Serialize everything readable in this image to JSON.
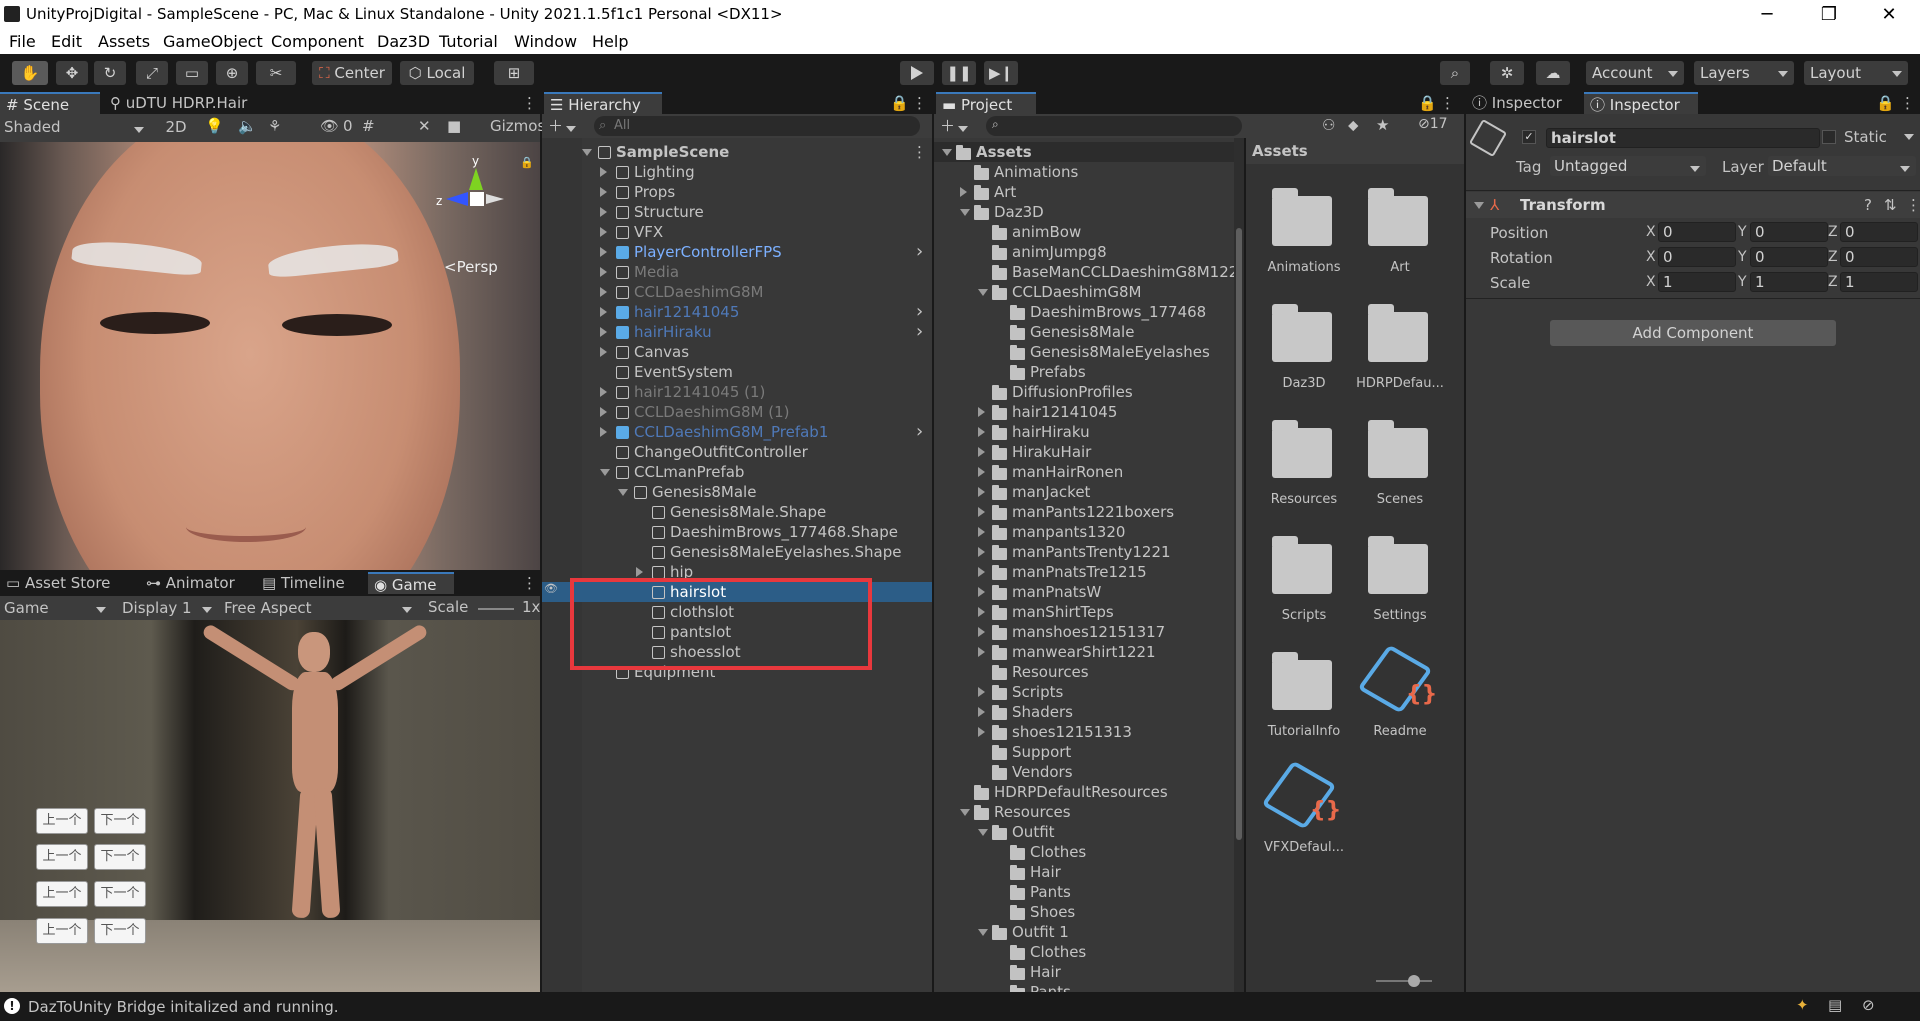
{
  "window": {
    "title": "UnityProjDigital - SampleScene - PC, Mac & Linux Standalone - Unity 2021.1.5f1c1 Personal <DX11>"
  },
  "menu": [
    "File",
    "Edit",
    "Assets",
    "GameObject",
    "Component",
    "Daz3D",
    "Tutorial",
    "Window",
    "Help"
  ],
  "toolbar": {
    "center": "Center",
    "local": "Local",
    "account": "Account",
    "layers": "Layers",
    "layout": "Layout"
  },
  "scene": {
    "tabs": [
      "Scene",
      "uDTU HDRP.Hair"
    ],
    "shading": "Shaded",
    "mode2d": "2D",
    "hidden_count": "0",
    "gizmos": "Gizmos",
    "persp": "<Persp",
    "axis_y": "y",
    "axis_z": "z"
  },
  "game": {
    "tabs": [
      "Asset Store",
      "Animator",
      "Timeline",
      "Game"
    ],
    "display_mode": "Game",
    "display": "Display 1",
    "aspect": "Free Aspect",
    "scale_label": "Scale",
    "scale_value": "1x",
    "buttons": [
      "上一个",
      "下一个",
      "上一个",
      "下一个",
      "上一个",
      "下一个",
      "上一个",
      "下一个"
    ]
  },
  "hierarchy": {
    "tab": "Hierarchy",
    "search_placeholder": "All",
    "items": [
      {
        "label": "SampleScene",
        "depth": 0,
        "exp": "open",
        "icon": "scene",
        "style": "bold"
      },
      {
        "label": "Lighting",
        "depth": 1,
        "exp": "closed",
        "icon": "cube",
        "style": "normal"
      },
      {
        "label": "Props",
        "depth": 1,
        "exp": "closed",
        "icon": "cube",
        "style": "normal"
      },
      {
        "label": "Structure",
        "depth": 1,
        "exp": "closed",
        "icon": "cube",
        "style": "normal"
      },
      {
        "label": "VFX",
        "depth": 1,
        "exp": "closed",
        "icon": "cube",
        "style": "normal"
      },
      {
        "label": "PlayerControllerFPS",
        "depth": 1,
        "exp": "closed",
        "icon": "prefab",
        "style": "prefab",
        "arrow": true
      },
      {
        "label": "Media",
        "depth": 1,
        "exp": "closed",
        "icon": "cube",
        "style": "dim"
      },
      {
        "label": "CCLDaeshimG8M",
        "depth": 1,
        "exp": "closed",
        "icon": "cube",
        "style": "dim"
      },
      {
        "label": "hair12141045",
        "depth": 1,
        "exp": "closed",
        "icon": "prefab",
        "style": "prefabdim",
        "arrow": true
      },
      {
        "label": "hairHiraku",
        "depth": 1,
        "exp": "closed",
        "icon": "prefab",
        "style": "prefabdim",
        "arrow": true
      },
      {
        "label": "Canvas",
        "depth": 1,
        "exp": "closed",
        "icon": "cube",
        "style": "normal"
      },
      {
        "label": "EventSystem",
        "depth": 1,
        "exp": "none",
        "icon": "cube",
        "style": "normal"
      },
      {
        "label": "hair12141045 (1)",
        "depth": 1,
        "exp": "closed",
        "icon": "cube",
        "style": "dim"
      },
      {
        "label": "CCLDaeshimG8M (1)",
        "depth": 1,
        "exp": "closed",
        "icon": "cube",
        "style": "dim"
      },
      {
        "label": "CCLDaeshimG8M_Prefab1",
        "depth": 1,
        "exp": "closed",
        "icon": "prefab",
        "style": "prefabdim",
        "arrow": true
      },
      {
        "label": "ChangeOutfitController",
        "depth": 1,
        "exp": "none",
        "icon": "cube",
        "style": "normal"
      },
      {
        "label": "CCLmanPrefab",
        "depth": 1,
        "exp": "open",
        "icon": "cube",
        "style": "normal"
      },
      {
        "label": "Genesis8Male",
        "depth": 2,
        "exp": "open",
        "icon": "cube",
        "style": "normal"
      },
      {
        "label": "Genesis8Male.Shape",
        "depth": 3,
        "exp": "none",
        "icon": "cube",
        "style": "normal"
      },
      {
        "label": "DaeshimBrows_177468.Shape",
        "depth": 3,
        "exp": "none",
        "icon": "cube",
        "style": "normal"
      },
      {
        "label": "Genesis8MaleEyelashes.Shape",
        "depth": 3,
        "exp": "none",
        "icon": "cube",
        "style": "normal"
      },
      {
        "label": "hip",
        "depth": 3,
        "exp": "closed",
        "icon": "cube",
        "style": "normal"
      },
      {
        "label": "hairslot",
        "depth": 3,
        "exp": "none",
        "icon": "cube",
        "style": "selected"
      },
      {
        "label": "clothslot",
        "depth": 3,
        "exp": "none",
        "icon": "cube",
        "style": "normal"
      },
      {
        "label": "pantslot",
        "depth": 3,
        "exp": "none",
        "icon": "cube",
        "style": "normal"
      },
      {
        "label": "shoesslot",
        "depth": 3,
        "exp": "none",
        "icon": "cube",
        "style": "normal"
      },
      {
        "label": "Equipment",
        "depth": 1,
        "exp": "none",
        "icon": "cube",
        "style": "normal"
      }
    ]
  },
  "project": {
    "tab": "Project",
    "hidden_count": "17",
    "breadcrumb": "Assets",
    "tree": [
      {
        "label": "Assets",
        "depth": 0,
        "exp": "open",
        "bold": true
      },
      {
        "label": "Animations",
        "depth": 1,
        "exp": "none"
      },
      {
        "label": "Art",
        "depth": 1,
        "exp": "closed"
      },
      {
        "label": "Daz3D",
        "depth": 1,
        "exp": "open"
      },
      {
        "label": "animBow",
        "depth": 2,
        "exp": "none"
      },
      {
        "label": "animJumpg8",
        "depth": 2,
        "exp": "none"
      },
      {
        "label": "BaseManCCLDaeshimG8M122",
        "depth": 2,
        "exp": "none"
      },
      {
        "label": "CCLDaeshimG8M",
        "depth": 2,
        "exp": "open"
      },
      {
        "label": "DaeshimBrows_177468",
        "depth": 3,
        "exp": "none"
      },
      {
        "label": "Genesis8Male",
        "depth": 3,
        "exp": "none"
      },
      {
        "label": "Genesis8MaleEyelashes",
        "depth": 3,
        "exp": "none"
      },
      {
        "label": "Prefabs",
        "depth": 3,
        "exp": "none"
      },
      {
        "label": "DiffusionProfiles",
        "depth": 2,
        "exp": "none"
      },
      {
        "label": "hair12141045",
        "depth": 2,
        "exp": "closed"
      },
      {
        "label": "hairHiraku",
        "depth": 2,
        "exp": "closed"
      },
      {
        "label": "HirakuHair",
        "depth": 2,
        "exp": "closed"
      },
      {
        "label": "manHairRonen",
        "depth": 2,
        "exp": "closed"
      },
      {
        "label": "manJacket",
        "depth": 2,
        "exp": "closed"
      },
      {
        "label": "manPants1221boxers",
        "depth": 2,
        "exp": "closed"
      },
      {
        "label": "manpants1320",
        "depth": 2,
        "exp": "closed"
      },
      {
        "label": "manPantsTrenty1221",
        "depth": 2,
        "exp": "closed"
      },
      {
        "label": "manPnatsTre1215",
        "depth": 2,
        "exp": "closed"
      },
      {
        "label": "manPnatsW",
        "depth": 2,
        "exp": "closed"
      },
      {
        "label": "manShirtTeps",
        "depth": 2,
        "exp": "closed"
      },
      {
        "label": "manshoes12151317",
        "depth": 2,
        "exp": "closed"
      },
      {
        "label": "manwearShirt1221",
        "depth": 2,
        "exp": "closed"
      },
      {
        "label": "Resources",
        "depth": 2,
        "exp": "none"
      },
      {
        "label": "Scripts",
        "depth": 2,
        "exp": "closed"
      },
      {
        "label": "Shaders",
        "depth": 2,
        "exp": "closed"
      },
      {
        "label": "shoes12151313",
        "depth": 2,
        "exp": "closed"
      },
      {
        "label": "Support",
        "depth": 2,
        "exp": "none"
      },
      {
        "label": "Vendors",
        "depth": 2,
        "exp": "none"
      },
      {
        "label": "HDRPDefaultResources",
        "depth": 1,
        "exp": "none"
      },
      {
        "label": "Resources",
        "depth": 1,
        "exp": "open"
      },
      {
        "label": "Outfit",
        "depth": 2,
        "exp": "open"
      },
      {
        "label": "Clothes",
        "depth": 3,
        "exp": "none"
      },
      {
        "label": "Hair",
        "depth": 3,
        "exp": "none"
      },
      {
        "label": "Pants",
        "depth": 3,
        "exp": "none"
      },
      {
        "label": "Shoes",
        "depth": 3,
        "exp": "none"
      },
      {
        "label": "Outfit 1",
        "depth": 2,
        "exp": "open"
      },
      {
        "label": "Clothes",
        "depth": 3,
        "exp": "none"
      },
      {
        "label": "Hair",
        "depth": 3,
        "exp": "none"
      },
      {
        "label": "Pants",
        "depth": 3,
        "exp": "none"
      }
    ],
    "grid": [
      {
        "label": "Animations",
        "type": "folder"
      },
      {
        "label": "Art",
        "type": "folder"
      },
      {
        "label": "Daz3D",
        "type": "folder"
      },
      {
        "label": "HDRPDefau...",
        "type": "folder"
      },
      {
        "label": "Resources",
        "type": "folder"
      },
      {
        "label": "Scenes",
        "type": "folder"
      },
      {
        "label": "Scripts",
        "type": "folder"
      },
      {
        "label": "Settings",
        "type": "folder"
      },
      {
        "label": "TutorialInfo",
        "type": "folder"
      },
      {
        "label": "Readme",
        "type": "asset"
      },
      {
        "label": "VFXDefaul...",
        "type": "asset"
      }
    ]
  },
  "inspector": {
    "tabs": [
      "Inspector",
      "Inspector"
    ],
    "object_name": "hairslot",
    "static_label": "Static",
    "tag_label": "Tag",
    "tag_value": "Untagged",
    "layer_label": "Layer",
    "layer_value": "Default",
    "component": "Transform",
    "rows": [
      {
        "label": "Position",
        "x": "0",
        "y": "0",
        "z": "0"
      },
      {
        "label": "Rotation",
        "x": "0",
        "y": "0",
        "z": "0"
      },
      {
        "label": "Scale",
        "x": "1",
        "y": "1",
        "z": "1"
      }
    ],
    "add_component": "Add Component"
  },
  "statusbar": {
    "message": "DazToUnity Bridge initalized and running."
  },
  "colors": {
    "accent": "#3a79bb",
    "selection": "#2c5d87",
    "highlight_box": "#e8383d",
    "prefab_text": "#7cb0ff"
  }
}
